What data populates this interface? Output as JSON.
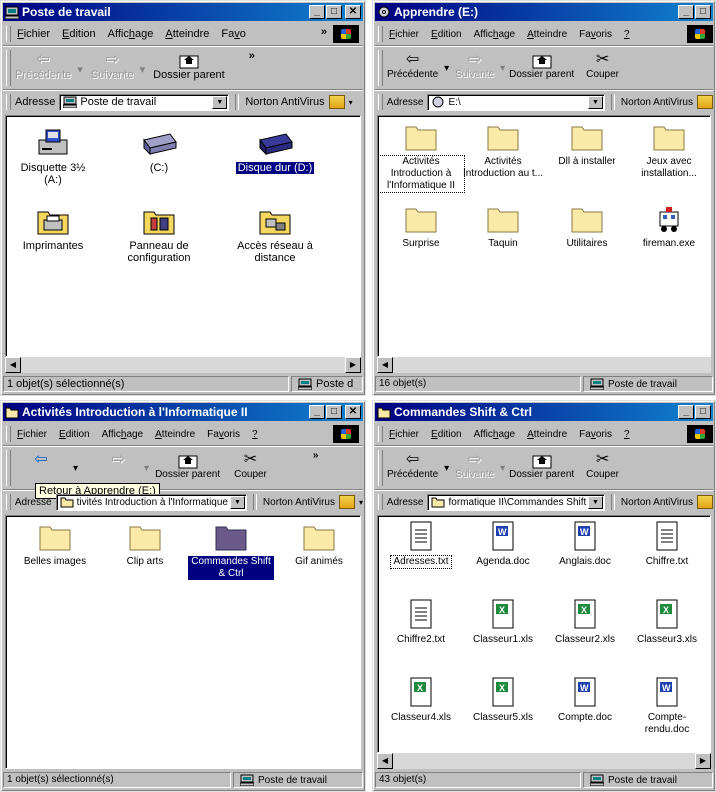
{
  "windows": [
    {
      "title": "Poste de travail",
      "menu": [
        {
          "pre": "",
          "u": "F",
          "post": "ichier"
        },
        {
          "pre": "",
          "u": "E",
          "post": "dition"
        },
        {
          "pre": "Affic",
          "u": "h",
          "post": "age"
        },
        {
          "pre": "",
          "u": "A",
          "post": "tteindre"
        },
        {
          "pre": "Fa",
          "u": "v",
          "post": "o"
        }
      ],
      "toolbar": {
        "back": "Précédente",
        "forward": "Suivante",
        "up": "Dossier parent"
      },
      "address": {
        "label": "Adresse",
        "value": "Poste de travail"
      },
      "norton": "Norton AntiVirus",
      "items": [
        {
          "label": "Disquette 3½ (A:)",
          "icon": "floppy-icon"
        },
        {
          "label": "(C:)",
          "icon": "hard-drive-icon"
        },
        {
          "label": "Disque dur (D:)",
          "icon": "hard-drive-icon",
          "selected": true
        },
        {
          "label": "Imprimantes",
          "icon": "printer-folder-icon"
        },
        {
          "label": "Panneau de configuration",
          "icon": "control-panel-icon"
        },
        {
          "label": "Accès réseau à distance",
          "icon": "dial-up-icon"
        }
      ],
      "status": "1 objet(s) sélectionné(s)",
      "status_right": "Poste d"
    },
    {
      "title": "Apprendre (E:)",
      "menu": [
        {
          "pre": "",
          "u": "F",
          "post": "ichier"
        },
        {
          "pre": "",
          "u": "E",
          "post": "dition"
        },
        {
          "pre": "Affic",
          "u": "h",
          "post": "age"
        },
        {
          "pre": "",
          "u": "A",
          "post": "tteindre"
        },
        {
          "pre": "Fa",
          "u": "v",
          "post": "oris"
        },
        {
          "pre": "",
          "u": "?",
          "post": ""
        }
      ],
      "toolbar": {
        "back": "Précédente",
        "forward": "Suivante",
        "up": "Dossier parent",
        "cut": "Couper"
      },
      "address": {
        "label": "Adresse",
        "value": "E:\\"
      },
      "norton": "Norton AntiVirus",
      "items": [
        {
          "label": "Activités Introduction à l'Informatique II",
          "icon": "folder-icon",
          "focused": true
        },
        {
          "label": "Activités Introduction au t...",
          "icon": "folder-icon"
        },
        {
          "label": "Dll à installer",
          "icon": "folder-icon"
        },
        {
          "label": "Jeux avec installation...",
          "icon": "folder-icon"
        },
        {
          "label": "Surprise",
          "icon": "folder-icon"
        },
        {
          "label": "Taquin",
          "icon": "folder-icon"
        },
        {
          "label": "Utilitaires",
          "icon": "folder-icon"
        },
        {
          "label": "fireman.exe",
          "icon": "fire-truck-icon"
        }
      ],
      "status": "16 objet(s)",
      "status_right": "Poste de travail"
    },
    {
      "title": "Activités Introduction à l'Informatique II",
      "menu": [
        {
          "pre": "",
          "u": "F",
          "post": "ichier"
        },
        {
          "pre": "",
          "u": "E",
          "post": "dition"
        },
        {
          "pre": "Affic",
          "u": "h",
          "post": "age"
        },
        {
          "pre": "",
          "u": "A",
          "post": "tteindre"
        },
        {
          "pre": "Fa",
          "u": "v",
          "post": "oris"
        },
        {
          "pre": "",
          "u": "?",
          "post": ""
        }
      ],
      "toolbar": {
        "back": "",
        "forward": "",
        "up": "Dossier parent",
        "cut": "Couper"
      },
      "tooltip": "Retour à Apprendre (E:)",
      "address": {
        "label": "Adresse",
        "value": "tivités Introduction à l'Informatique II"
      },
      "norton": "Norton AntiVirus",
      "items": [
        {
          "label": "Belles images",
          "icon": "folder-icon"
        },
        {
          "label": "Clip arts",
          "icon": "folder-icon"
        },
        {
          "label": "Commandes Shift & Ctrl",
          "icon": "folder-icon",
          "selected": true
        },
        {
          "label": "Gif animés",
          "icon": "folder-icon"
        }
      ],
      "status": "1 objet(s) sélectionné(s)",
      "status_right": "Poste de travail"
    },
    {
      "title": "Commandes Shift & Ctrl",
      "menu": [
        {
          "pre": "",
          "u": "F",
          "post": "ichier"
        },
        {
          "pre": "",
          "u": "E",
          "post": "dition"
        },
        {
          "pre": "Affic",
          "u": "h",
          "post": "age"
        },
        {
          "pre": "",
          "u": "A",
          "post": "tteindre"
        },
        {
          "pre": "Fa",
          "u": "v",
          "post": "oris"
        },
        {
          "pre": "",
          "u": "?",
          "post": ""
        }
      ],
      "toolbar": {
        "back": "Précédente",
        "forward": "Suivante",
        "up": "Dossier parent",
        "cut": "Couper"
      },
      "address": {
        "label": "Adresse",
        "value": "formatique II\\Commandes Shift & Ctrl"
      },
      "norton": "Norton AntiVirus",
      "items": [
        {
          "label": "Adresses.txt",
          "icon": "text-file-icon",
          "focused": true
        },
        {
          "label": "Agenda.doc",
          "icon": "word-doc-icon"
        },
        {
          "label": "Anglais.doc",
          "icon": "word-doc-icon"
        },
        {
          "label": "Chiffre.txt",
          "icon": "text-file-icon"
        },
        {
          "label": "Chiffre2.txt",
          "icon": "text-file-icon"
        },
        {
          "label": "Classeur1.xls",
          "icon": "excel-file-icon"
        },
        {
          "label": "Classeur2.xls",
          "icon": "excel-file-icon"
        },
        {
          "label": "Classeur3.xls",
          "icon": "excel-file-icon"
        },
        {
          "label": "Classeur4.xls",
          "icon": "excel-file-icon"
        },
        {
          "label": "Classeur5.xls",
          "icon": "excel-file-icon"
        },
        {
          "label": "Compte.doc",
          "icon": "word-doc-icon"
        },
        {
          "label": "Compte-rendu.doc",
          "icon": "word-doc-icon"
        }
      ],
      "status": "43 objet(s)",
      "status_right": "Poste de travail"
    }
  ]
}
